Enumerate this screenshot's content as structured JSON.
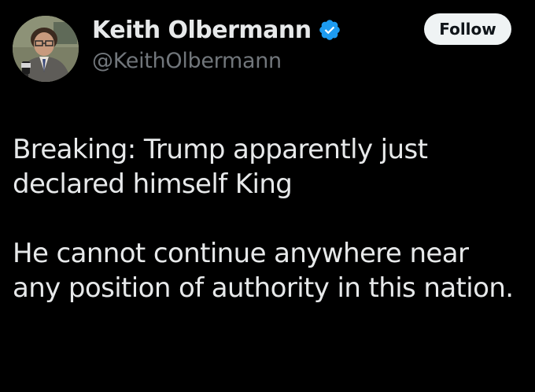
{
  "author": {
    "display_name": "Keith Olbermann",
    "handle": "@KeithOlbermann",
    "verified": true,
    "verified_color": "#1d9bf0",
    "avatar_icon": "profile-photo"
  },
  "actions": {
    "follow_label": "Follow"
  },
  "tweet": {
    "paragraphs": [
      "Breaking: Trump apparently just declared himself King",
      "He cannot continue anywhere near any position of authority in this nation."
    ]
  },
  "colors": {
    "background": "#000000",
    "text_primary": "#e7e9ea",
    "text_secondary": "#71767b",
    "button_bg": "#eff3f4",
    "button_text": "#0f1419"
  }
}
